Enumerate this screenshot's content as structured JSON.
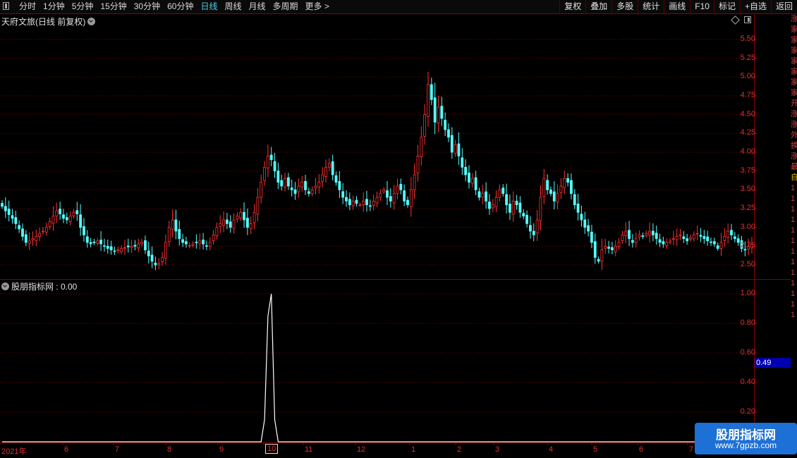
{
  "toolbar": {
    "periods": [
      {
        "label": "分时",
        "active": false
      },
      {
        "label": "1分钟",
        "active": false
      },
      {
        "label": "5分钟",
        "active": false
      },
      {
        "label": "15分钟",
        "active": false
      },
      {
        "label": "30分钟",
        "active": false
      },
      {
        "label": "60分钟",
        "active": false
      },
      {
        "label": "日线",
        "active": true
      },
      {
        "label": "周线",
        "active": false
      },
      {
        "label": "月线",
        "active": false
      },
      {
        "label": "多周期",
        "active": false
      },
      {
        "label": "更多 >",
        "active": false
      }
    ],
    "tools": [
      "复权",
      "叠加",
      "多股",
      "统计",
      "画线",
      "F10",
      "标记",
      "+自选",
      "返回"
    ]
  },
  "main": {
    "title": "天府文旅(日线 前复权)",
    "y_ticks": [
      "5.50",
      "5.25",
      "5.00",
      "4.75",
      "4.50",
      "4.25",
      "4.00",
      "3.75",
      "3.50",
      "3.25",
      "3.00",
      "2.75",
      "2.50"
    ]
  },
  "indicator": {
    "title": "股朋指标网 : 0.00",
    "y_ticks": [
      "1.00",
      "0.80",
      "0.60",
      "0.40",
      "0.20"
    ],
    "current_value": "0.49"
  },
  "x_axis": {
    "labels": [
      "2021年",
      "6",
      "7",
      "8",
      "9",
      "10",
      "11",
      "12",
      "1",
      "2",
      "3",
      "4",
      "5",
      "6",
      "7"
    ],
    "highlight": "10"
  },
  "side_panel": {
    "chars": [
      "涨",
      "家",
      "家",
      "家",
      "家",
      "家",
      "家",
      "家",
      "开",
      "涨",
      "涨",
      "外",
      "换",
      "涨",
      "最",
      "自",
      "1",
      "1",
      "1",
      "1",
      "1",
      "1",
      "1",
      "1",
      "1",
      "1",
      "1",
      "1",
      "1"
    ]
  },
  "watermark": {
    "line1": "股朋指标网",
    "line2": "www.7gpzb.com"
  },
  "colors": {
    "up": "#ff3232",
    "down": "#54ffff",
    "grid": "#8b0000",
    "axis_text": "#e03030",
    "active_period": "#4fd0e8",
    "indicator_line": "#ffffff",
    "highlight_box": "#0000b0"
  },
  "chart_data": [
    {
      "type": "candlestick",
      "title": "天府文旅(日线 前复权)",
      "ylim": [
        2.5,
        5.5
      ],
      "x_labels": [
        "2021年",
        "6",
        "7",
        "8",
        "9",
        "10",
        "11",
        "12",
        "1",
        "2",
        "3",
        "4",
        "5",
        "6",
        "7"
      ],
      "close": [
        3.28,
        3.22,
        3.17,
        3.12,
        3.05,
        2.98,
        2.88,
        2.8,
        2.82,
        2.85,
        2.88,
        2.92,
        2.95,
        3.0,
        3.08,
        3.15,
        3.22,
        3.18,
        3.12,
        3.1,
        3.15,
        3.2,
        3.18,
        3.0,
        2.9,
        2.8,
        2.78,
        2.8,
        2.82,
        2.78,
        2.75,
        2.72,
        2.7,
        2.68,
        2.7,
        2.72,
        2.73,
        2.74,
        2.75,
        2.75,
        2.78,
        2.8,
        2.7,
        2.62,
        2.55,
        2.5,
        2.52,
        2.6,
        2.8,
        3.0,
        3.1,
        2.95,
        2.85,
        2.8,
        2.78,
        2.76,
        2.78,
        2.8,
        2.82,
        2.78,
        2.75,
        2.8,
        2.9,
        3.0,
        3.05,
        3.1,
        3.05,
        3.0,
        3.1,
        3.15,
        3.2,
        3.1,
        3.0,
        3.05,
        3.2,
        3.4,
        3.6,
        3.8,
        3.95,
        3.9,
        3.75,
        3.6,
        3.55,
        3.65,
        3.55,
        3.5,
        3.45,
        3.55,
        3.6,
        3.5,
        3.45,
        3.5,
        3.55,
        3.6,
        3.7,
        3.8,
        3.85,
        3.7,
        3.6,
        3.5,
        3.4,
        3.35,
        3.3,
        3.35,
        3.32,
        3.3,
        3.35,
        3.3,
        3.28,
        3.35,
        3.4,
        3.45,
        3.5,
        3.4,
        3.35,
        3.45,
        3.55,
        3.5,
        3.35,
        3.3,
        3.5,
        3.7,
        3.95,
        4.2,
        4.5,
        4.9,
        4.7,
        4.4,
        4.6,
        4.45,
        4.3,
        4.2,
        4.0,
        4.1,
        3.95,
        3.8,
        3.7,
        3.6,
        3.65,
        3.5,
        3.4,
        3.45,
        3.35,
        3.25,
        3.3,
        3.4,
        3.5,
        3.45,
        3.3,
        3.2,
        3.35,
        3.3,
        3.2,
        3.15,
        3.05,
        2.95,
        2.9,
        3.1,
        3.4,
        3.65,
        3.5,
        3.45,
        3.35,
        3.45,
        3.55,
        3.65,
        3.6,
        3.45,
        3.3,
        3.2,
        3.1,
        3.0,
        2.95,
        2.8,
        2.6,
        2.55,
        2.7,
        2.75,
        2.72,
        2.7,
        2.75,
        2.8,
        2.9,
        2.95,
        2.85,
        2.8,
        2.85,
        2.9,
        2.88,
        2.92,
        2.95,
        2.9,
        2.85,
        2.8,
        2.78,
        2.8,
        2.82,
        2.85,
        2.88,
        2.9,
        2.85,
        2.82,
        2.86,
        2.9,
        2.92,
        2.88,
        2.85,
        2.82,
        2.8,
        2.78,
        2.72,
        2.8,
        2.88,
        2.95,
        2.9,
        2.85,
        2.8,
        2.72,
        2.7,
        2.75,
        2.78
      ]
    },
    {
      "type": "line",
      "title": "股朋指标网",
      "ylim": [
        0,
        1.0
      ],
      "series": [
        {
          "values": [
            0,
            0,
            0,
            0,
            0,
            0,
            0,
            0,
            0,
            0,
            0,
            0,
            0,
            0,
            0,
            0,
            0,
            0,
            0,
            0,
            0,
            0,
            0,
            0,
            0,
            0,
            0,
            0,
            0,
            0,
            0,
            0,
            0,
            0,
            0,
            0,
            0,
            0,
            0,
            0,
            0,
            0,
            0,
            0,
            0,
            0,
            0,
            0,
            0,
            0,
            0,
            0,
            0,
            0,
            0,
            0,
            0,
            0,
            0,
            0,
            0,
            0,
            0,
            0,
            0,
            0,
            0,
            0,
            0,
            0,
            0,
            0,
            0,
            0,
            0,
            0,
            0,
            0.15,
            0.85,
            1.0,
            0.15,
            0,
            0,
            0,
            0,
            0,
            0,
            0,
            0,
            0,
            0,
            0,
            0,
            0,
            0,
            0,
            0,
            0,
            0,
            0,
            0,
            0,
            0,
            0,
            0,
            0,
            0,
            0,
            0,
            0,
            0,
            0,
            0,
            0,
            0,
            0,
            0,
            0,
            0,
            0,
            0,
            0,
            0,
            0,
            0,
            0,
            0,
            0,
            0,
            0,
            0,
            0,
            0,
            0,
            0,
            0,
            0,
            0,
            0,
            0,
            0,
            0,
            0,
            0,
            0,
            0,
            0,
            0,
            0,
            0,
            0,
            0,
            0,
            0,
            0,
            0,
            0,
            0,
            0,
            0,
            0,
            0,
            0,
            0,
            0,
            0,
            0,
            0,
            0,
            0,
            0,
            0,
            0,
            0,
            0,
            0,
            0,
            0,
            0,
            0,
            0,
            0,
            0,
            0,
            0,
            0,
            0,
            0,
            0,
            0,
            0,
            0,
            0,
            0,
            0,
            0,
            0,
            0,
            0,
            0,
            0,
            0,
            0,
            0,
            0,
            0,
            0,
            0,
            0,
            0,
            0,
            0,
            0,
            0,
            0,
            0,
            0,
            0,
            0,
            0,
            0,
            0,
            0,
            0,
            0,
            0
          ]
        }
      ]
    }
  ]
}
